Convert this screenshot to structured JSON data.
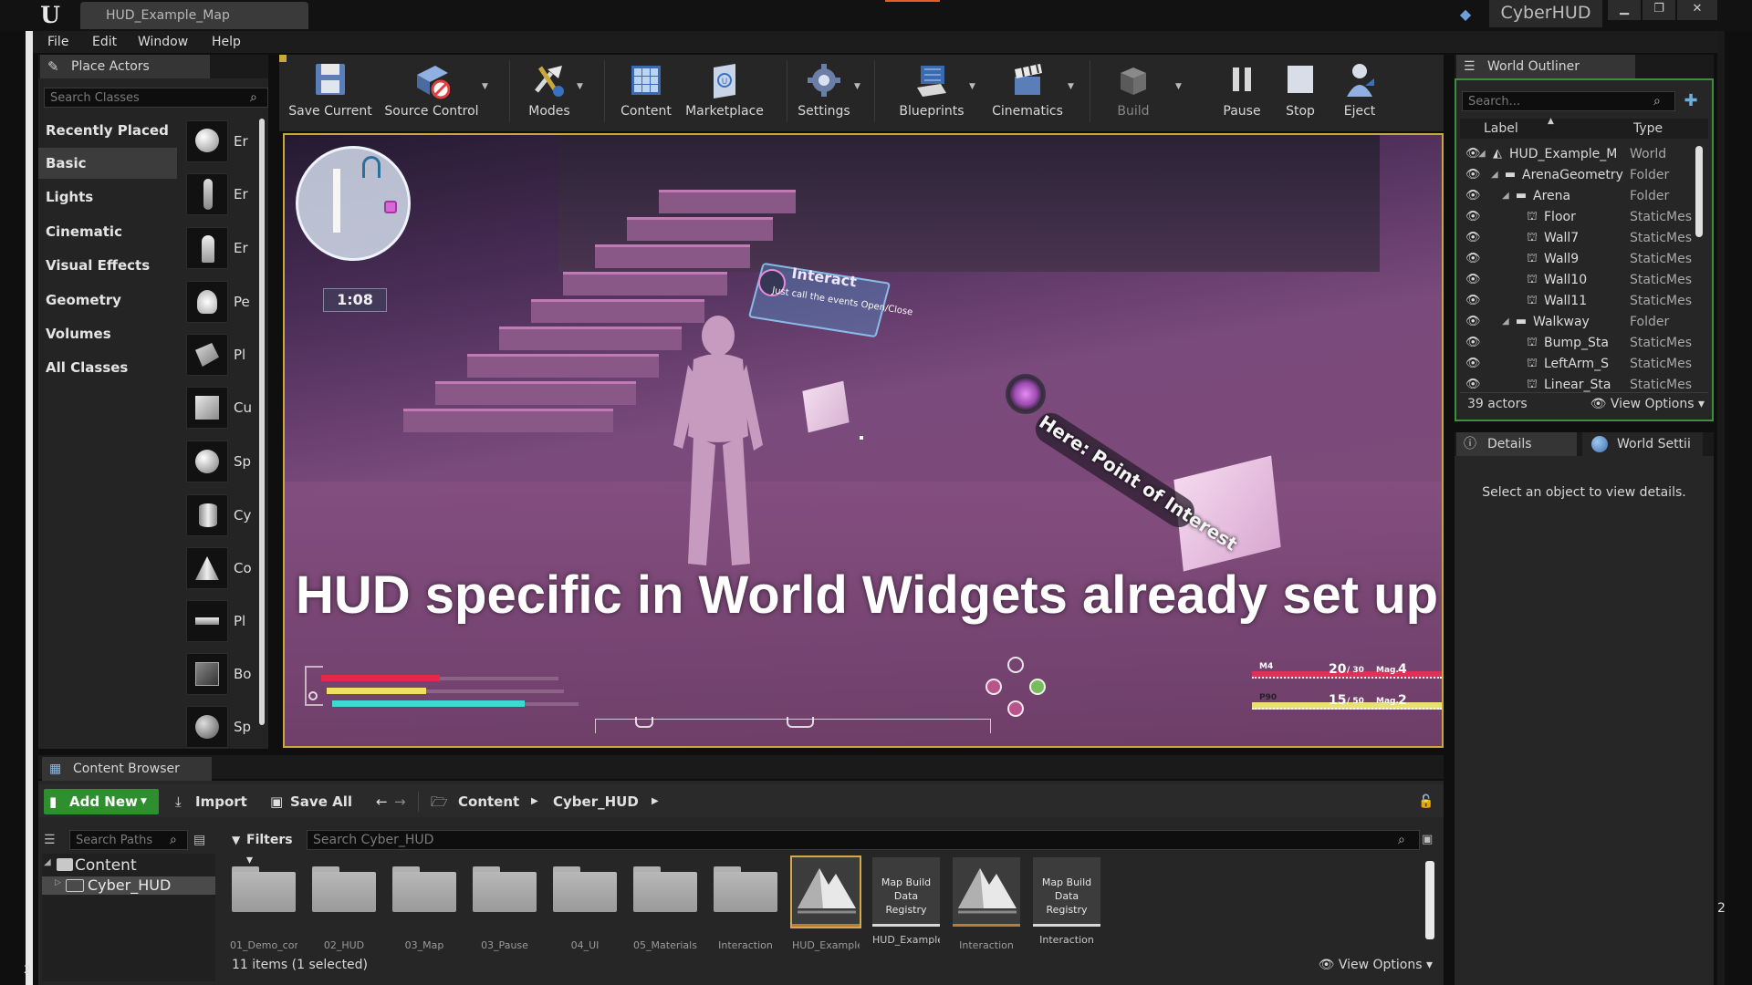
{
  "window": {
    "map_tab": "HUD_Example_Map",
    "project_name": "CyberHUD",
    "min": "▁",
    "max": "❐",
    "close": "✕"
  },
  "menu": [
    "File",
    "Edit",
    "Window",
    "Help"
  ],
  "place_actors": {
    "tab_label": "Place Actors",
    "search_placeholder": "Search Classes",
    "categories": [
      "Recently Placed",
      "Basic",
      "Lights",
      "Cinematic",
      "Visual Effects",
      "Geometry",
      "Volumes",
      "All Classes"
    ],
    "selected_category": "Basic",
    "items": [
      "Er",
      "Er",
      "Er",
      "Pe",
      "Pl",
      "Cu",
      "Sp",
      "Cy",
      "Co",
      "Pl",
      "Bo",
      "Sp"
    ]
  },
  "toolbar": {
    "save_current": "Save Current",
    "source_control": "Source Control",
    "modes": "Modes",
    "content": "Content",
    "marketplace": "Marketplace",
    "settings": "Settings",
    "blueprints": "Blueprints",
    "cinematics": "Cinematics",
    "build": "Build",
    "pause": "Pause",
    "stop": "Stop",
    "eject": "Eject"
  },
  "viewport": {
    "timer": "1:08",
    "interact_title": "Interact",
    "interact_subtitle": "Just call the events Open/Close",
    "poi_label": "Here: Point of Interest",
    "banner": "HUD specific in World Widgets already set up",
    "health_level": 0.5,
    "stamina_level": 0.42,
    "shield_level": 0.78,
    "weapon1": {
      "name": "M4",
      "ammo": "20",
      "reserve": "/ 30",
      "mag_label": "Mag.",
      "mags": "4",
      "color": "#e0305a"
    },
    "weapon2": {
      "name": "P90",
      "ammo": "15",
      "reserve": "/ 50",
      "mag_label": "Mag.",
      "mags": "2",
      "color": "#e8e070"
    }
  },
  "outliner": {
    "tab_label": "World Outliner",
    "search_placeholder": "Search...",
    "col_label": "Label",
    "col_type": "Type",
    "rows": [
      {
        "name": "HUD_Example_M",
        "type": "World"
      },
      {
        "name": "ArenaGeometry",
        "type": "Folder"
      },
      {
        "name": "Arena",
        "type": "Folder"
      },
      {
        "name": "Floor",
        "type": "StaticMes"
      },
      {
        "name": "Wall7",
        "type": "StaticMes"
      },
      {
        "name": "Wall9",
        "type": "StaticMes"
      },
      {
        "name": "Wall10",
        "type": "StaticMes"
      },
      {
        "name": "Wall11",
        "type": "StaticMes"
      },
      {
        "name": "Walkway",
        "type": "Folder"
      },
      {
        "name": "Bump_Sta",
        "type": "StaticMes"
      },
      {
        "name": "LeftArm_S",
        "type": "StaticMes"
      },
      {
        "name": "Linear_Sta",
        "type": "StaticMes"
      }
    ],
    "actor_count": "39 actors",
    "view_options": "View Options"
  },
  "details": {
    "tab_label": "Details",
    "world_settings_label": "World Settii",
    "empty_message": "Select an object to view details."
  },
  "content_browser": {
    "tab_label": "Content Browser",
    "add_new": "Add New",
    "import": "Import",
    "save_all": "Save All",
    "path_root": "Content",
    "path_folder": "Cyber_HUD",
    "search_paths_placeholder": "Search Paths",
    "filters": "Filters",
    "search_placeholder": "Search Cyber_HUD",
    "tree_root": "Content",
    "tree_child": "Cyber_HUD",
    "assets": [
      {
        "name": "01_Demo_con",
        "kind": "folder"
      },
      {
        "name": "02_HUD",
        "kind": "folder"
      },
      {
        "name": "03_Map",
        "kind": "folder"
      },
      {
        "name": "03_Pause",
        "kind": "folder"
      },
      {
        "name": "04_UI",
        "kind": "folder"
      },
      {
        "name": "05_Materials",
        "kind": "folder"
      },
      {
        "name": "Interaction",
        "kind": "folder"
      },
      {
        "name": "HUD_Example",
        "kind": "map"
      },
      {
        "name": "HUD_Example",
        "kind": "registry",
        "card_text": "Map Build Data Registry"
      },
      {
        "name": "Interaction",
        "kind": "map"
      },
      {
        "name": "Interaction",
        "kind": "registry",
        "card_text": "Map Build Data Registry"
      }
    ],
    "status": "11 items (1 selected)",
    "view_options": "View Options"
  },
  "edge": {
    "right_num": "2",
    "left_num": "2"
  }
}
